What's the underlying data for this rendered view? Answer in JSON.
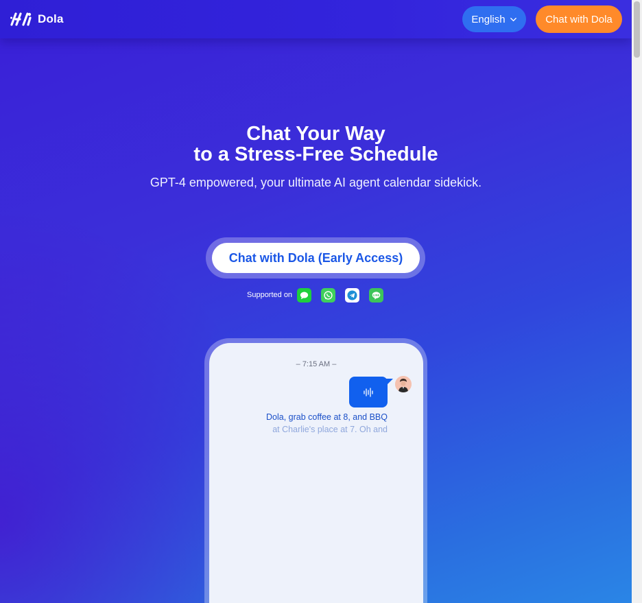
{
  "header": {
    "logo_text": "Dola",
    "language_label": "English",
    "cta_label": "Chat with Dola"
  },
  "hero": {
    "title_line1": "Chat Your Way",
    "title_line2": "to a Stress-Free Schedule",
    "subtitle": "GPT-4 empowered, your ultimate AI agent calendar sidekick.",
    "cta_label": "Chat with Dola (Early Access)",
    "supported_label": "Supported on",
    "platforms": [
      {
        "name": "imessage-icon",
        "color": "#1fcf3e"
      },
      {
        "name": "whatsapp-icon",
        "color": "#3fcf5c"
      },
      {
        "name": "telegram-icon",
        "color": "#1e8fd6"
      },
      {
        "name": "line-icon",
        "color": "#3dc45a"
      }
    ]
  },
  "phone": {
    "time": "– 7:15 AM –",
    "message_line1": "Dola, grab coffee at 8, and BBQ",
    "message_line2": "at Charlie's place at 7. Oh and"
  },
  "colors": {
    "accent_orange": "#ff8a2a",
    "accent_blue": "#1b57e6",
    "background_purple": "#3a1fd8"
  }
}
